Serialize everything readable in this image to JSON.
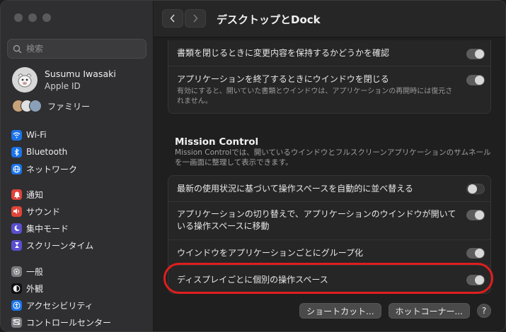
{
  "window": {
    "title": "デスクトップとDock"
  },
  "sidebar": {
    "search_placeholder": "検索",
    "profile": {
      "name": "Susumu Iwasaki",
      "subtitle": "Apple ID"
    },
    "family_label": "ファミリー",
    "groups": [
      [
        {
          "label": "Wi-Fi",
          "icon": "wifi-icon",
          "color": "#1a73e8"
        },
        {
          "label": "Bluetooth",
          "icon": "bluetooth-icon",
          "color": "#1a73e8"
        },
        {
          "label": "ネットワーク",
          "icon": "globe-icon",
          "color": "#1a73e8"
        }
      ],
      [
        {
          "label": "通知",
          "icon": "bell-icon",
          "color": "#e0443a"
        },
        {
          "label": "サウンド",
          "icon": "speaker-icon",
          "color": "#e0443a"
        },
        {
          "label": "集中モード",
          "icon": "moon-icon",
          "color": "#5a4fcf"
        },
        {
          "label": "スクリーンタイム",
          "icon": "hourglass-icon",
          "color": "#5a4fcf"
        }
      ],
      [
        {
          "label": "一般",
          "icon": "gear-icon",
          "color": "#7b7b7f"
        },
        {
          "label": "外観",
          "icon": "appearance-icon",
          "color": "#111111"
        },
        {
          "label": "アクセシビリティ",
          "icon": "accessibility-icon",
          "color": "#1a73e8"
        },
        {
          "label": "コントロールセンター",
          "icon": "control-center-icon",
          "color": "#7b7b7f"
        }
      ]
    ]
  },
  "main": {
    "top_group": [
      {
        "label": "書類を閉じるときに変更内容を保持するかどうかを確認",
        "on": true
      },
      {
        "label": "アプリケーションを終了するときにウインドウを閉じる",
        "desc": "有効にすると、開いていた書類とウインドウは、アプリケーションの再開時には復元されません。",
        "on": true
      }
    ],
    "mission_control": {
      "title": "Mission Control",
      "desc": "Mission Controlでは、開いているウインドウとフルスクリーンアプリケーションのサムネールを一画面に整理して表示できます。",
      "rows": [
        {
          "label": "最新の使用状況に基づいて操作スペースを自動的に並べ替える",
          "on": false
        },
        {
          "label": "アプリケーションの切り替えで、アプリケーションのウインドウが開いている操作スペースに移動",
          "on": true
        },
        {
          "label": "ウインドウをアプリケーションごとにグループ化",
          "on": true
        },
        {
          "label": "ディスプレイごとに個別の操作スペース",
          "on": true
        }
      ]
    },
    "buttons": {
      "shortcuts": "ショートカット...",
      "hot_corners": "ホットコーナー...",
      "help": "?"
    }
  }
}
